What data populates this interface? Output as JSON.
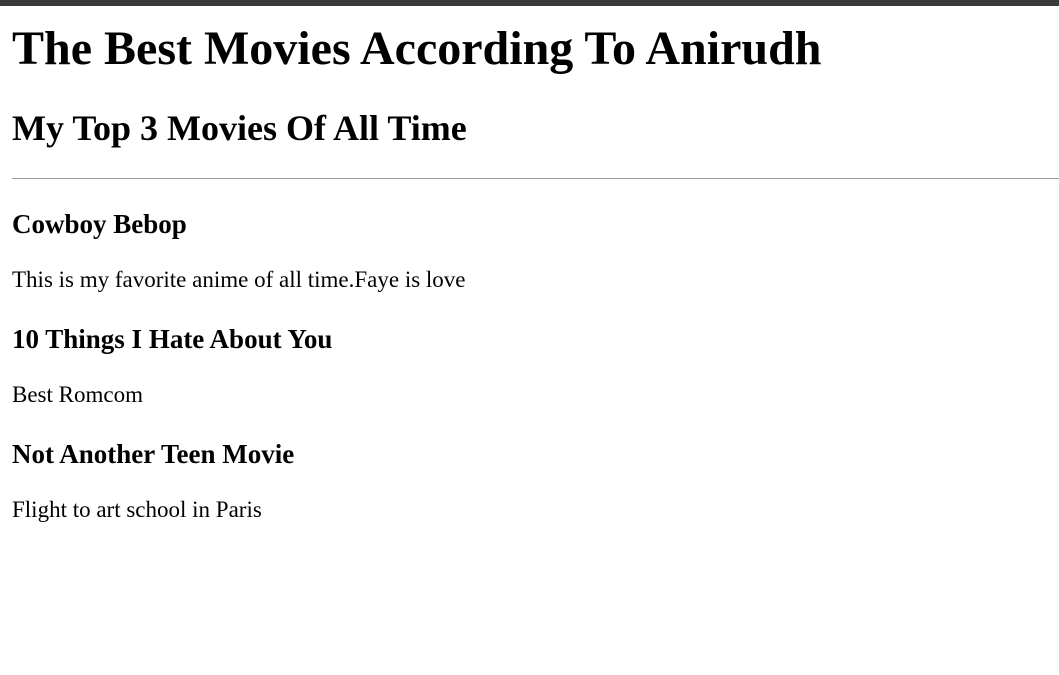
{
  "page": {
    "title": "The Best Movies According To Anirudh",
    "subtitle": "My Top 3 Movies Of All Time"
  },
  "movies": [
    {
      "title": "Cowboy Bebop",
      "description": "This is my favorite anime of all time.Faye is love"
    },
    {
      "title": "10 Things I Hate About You",
      "description": "Best Romcom"
    },
    {
      "title": "Not Another Teen Movie",
      "description": "Flight to art school in Paris"
    }
  ]
}
